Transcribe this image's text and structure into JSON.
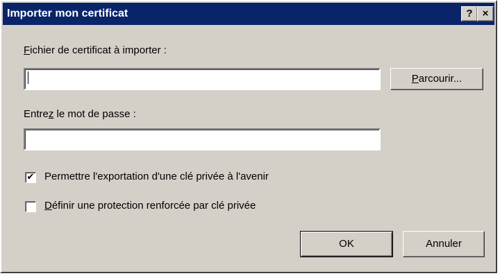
{
  "window": {
    "title": "Importer mon certificat",
    "help_button": "?",
    "close_button": "×"
  },
  "file_field": {
    "label_access": "F",
    "label_rest": "ichier de certificat à importer :",
    "value": "",
    "browse_access": "P",
    "browse_rest": "arcourir..."
  },
  "password_field": {
    "label_before": "Entre",
    "label_access": "z",
    "label_after": " le mot de passe :",
    "value": ""
  },
  "options": {
    "export_label": "Permettre l'exportation d'une clé privée à l'avenir",
    "export_checked": true,
    "export_mark": "✔",
    "protection_access": "D",
    "protection_rest": "éfinir une protection renforcée par clé privée",
    "protection_checked": false
  },
  "buttons": {
    "ok": "OK",
    "cancel": "Annuler"
  }
}
